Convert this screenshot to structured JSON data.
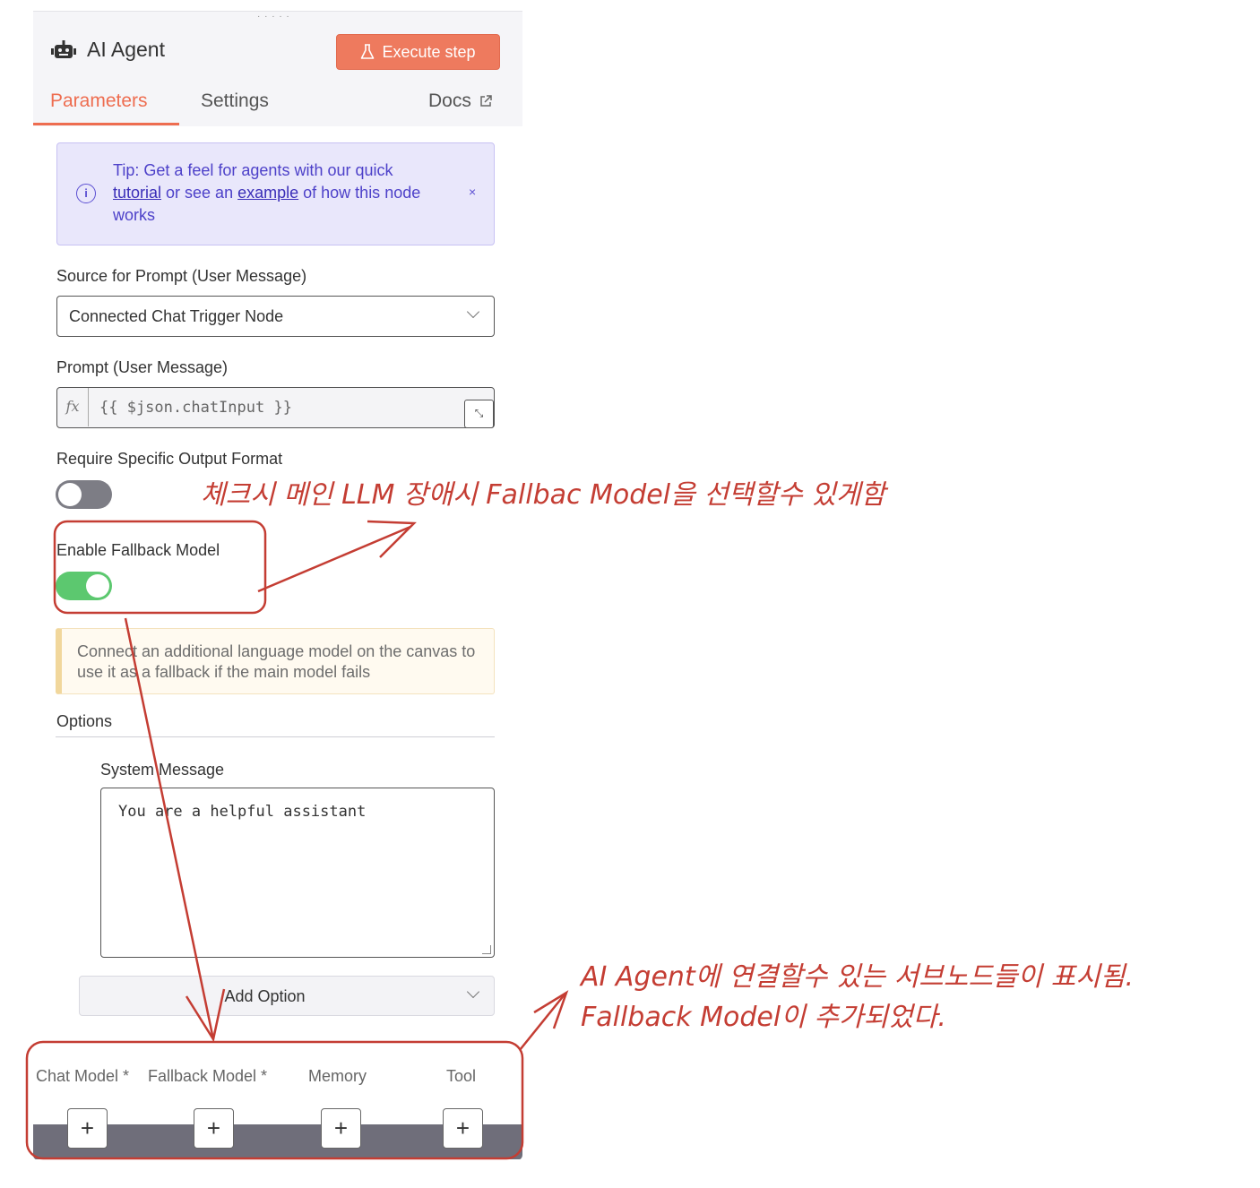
{
  "node": {
    "title": "AI Agent",
    "execute_label": "Execute step",
    "tabs": [
      "Parameters",
      "Settings"
    ],
    "docs_label": "Docs"
  },
  "tip": {
    "prefix": "Tip: Get a feel for agents with our quick ",
    "tutorial_link": "tutorial",
    "middle": " or see an ",
    "example_link": "example",
    "suffix": " of how this node works",
    "close": "×"
  },
  "source": {
    "label": "Source for Prompt (User Message)",
    "value": "Connected Chat Trigger Node"
  },
  "prompt": {
    "label": "Prompt (User Message)",
    "fx": "fx",
    "value": "{{ $json.chatInput }}"
  },
  "output_format": {
    "label": "Require Specific Output Format",
    "enabled": false
  },
  "fallback": {
    "label": "Enable Fallback Model",
    "enabled": true,
    "notice": "Connect an additional language model on the canvas to use it as a fallback if the main model fails"
  },
  "options": {
    "label": "Options",
    "system_message_label": "System Message",
    "system_message_value": "You are a helpful assistant",
    "add_option_label": "Add Option"
  },
  "subnodes": [
    {
      "label": "Chat Model *"
    },
    {
      "label": "Fallback Model *"
    },
    {
      "label": "Memory"
    },
    {
      "label": "Tool"
    }
  ],
  "add_symbol": "+",
  "annotations": {
    "top": "체크시 메인 LLM 장애시 Fallbac Model을 선택할수 있게함",
    "bottom_line1": "AI Agent에 연결할수 있는 서브노드들이 표시됨.",
    "bottom_line2": "Fallback Model이 추가되었다."
  },
  "colors": {
    "accent": "#ee6d50",
    "annotation": "#c43d33",
    "toggle_on": "#5cc86f",
    "tip_bg": "#e9e7fb"
  }
}
